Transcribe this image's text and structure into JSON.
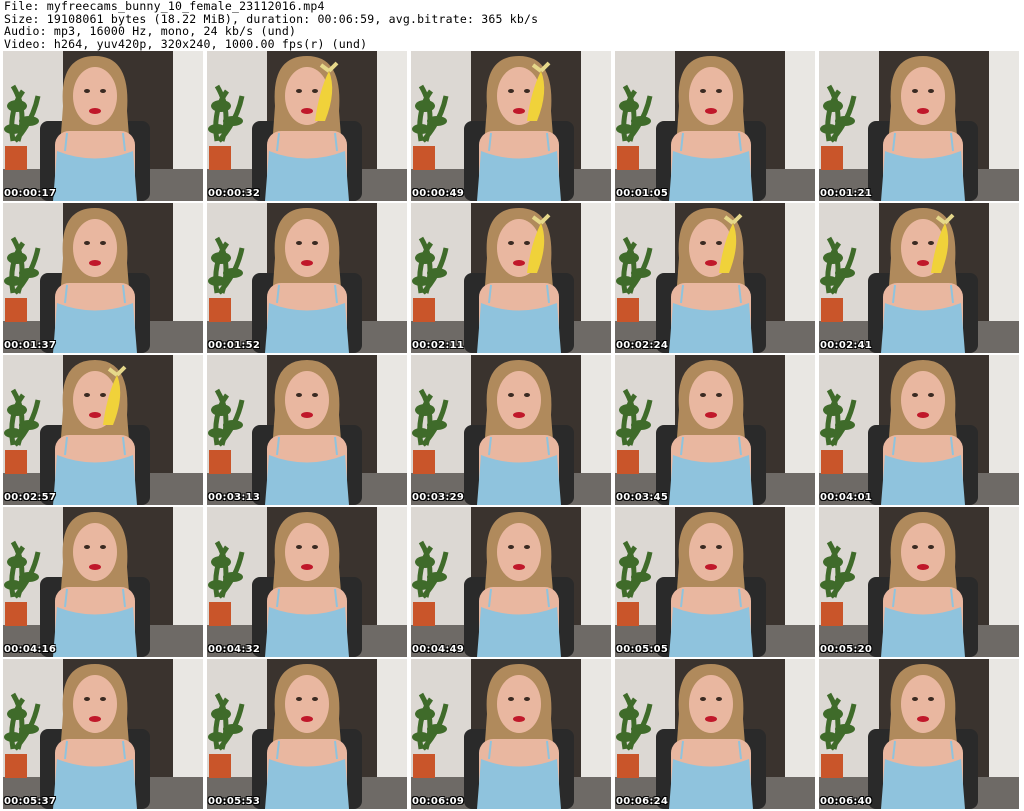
{
  "header": {
    "file_line": "File: myfreecams_bunny_10_female_23112016.mp4",
    "size_line": "Size: 19108061 bytes (18.22 MiB), duration: 00:06:59, avg.bitrate: 365 kb/s",
    "audio_line": "Audio: mp3, 16000 Hz, mono, 24 kb/s (und)",
    "video_line": "Video: h264, yuv420p, 320x240, 1000.00 fps(r) (und)"
  },
  "thumbnails": [
    {
      "timestamp": "00:00:17",
      "banana": false
    },
    {
      "timestamp": "00:00:32",
      "banana": true
    },
    {
      "timestamp": "00:00:49",
      "banana": true
    },
    {
      "timestamp": "00:01:05",
      "banana": false
    },
    {
      "timestamp": "00:01:21",
      "banana": false
    },
    {
      "timestamp": "00:01:37",
      "banana": false
    },
    {
      "timestamp": "00:01:52",
      "banana": false
    },
    {
      "timestamp": "00:02:11",
      "banana": true
    },
    {
      "timestamp": "00:02:24",
      "banana": true
    },
    {
      "timestamp": "00:02:41",
      "banana": true
    },
    {
      "timestamp": "00:02:57",
      "banana": true
    },
    {
      "timestamp": "00:03:13",
      "banana": false
    },
    {
      "timestamp": "00:03:29",
      "banana": false
    },
    {
      "timestamp": "00:03:45",
      "banana": false
    },
    {
      "timestamp": "00:04:01",
      "banana": false
    },
    {
      "timestamp": "00:04:16",
      "banana": false
    },
    {
      "timestamp": "00:04:32",
      "banana": false
    },
    {
      "timestamp": "00:04:49",
      "banana": false
    },
    {
      "timestamp": "00:05:05",
      "banana": false
    },
    {
      "timestamp": "00:05:20",
      "banana": false
    },
    {
      "timestamp": "00:05:37",
      "banana": false
    },
    {
      "timestamp": "00:05:53",
      "banana": false
    },
    {
      "timestamp": "00:06:09",
      "banana": false
    },
    {
      "timestamp": "00:06:24",
      "banana": false
    },
    {
      "timestamp": "00:06:40",
      "banana": false
    }
  ],
  "colors": {
    "background": "#ffffff",
    "wall": "#dcd8d3",
    "door": "#3a332e",
    "chair": "#2a2a2a",
    "top": "#8fc3dd",
    "hair": "#b08a5c",
    "skin": "#e9b7a0",
    "lips": "#c0182a",
    "plant": "#3f6b2a",
    "pot": "#c9552a",
    "banana": "#f0d23a",
    "timestamp_text": "#ffffff"
  }
}
